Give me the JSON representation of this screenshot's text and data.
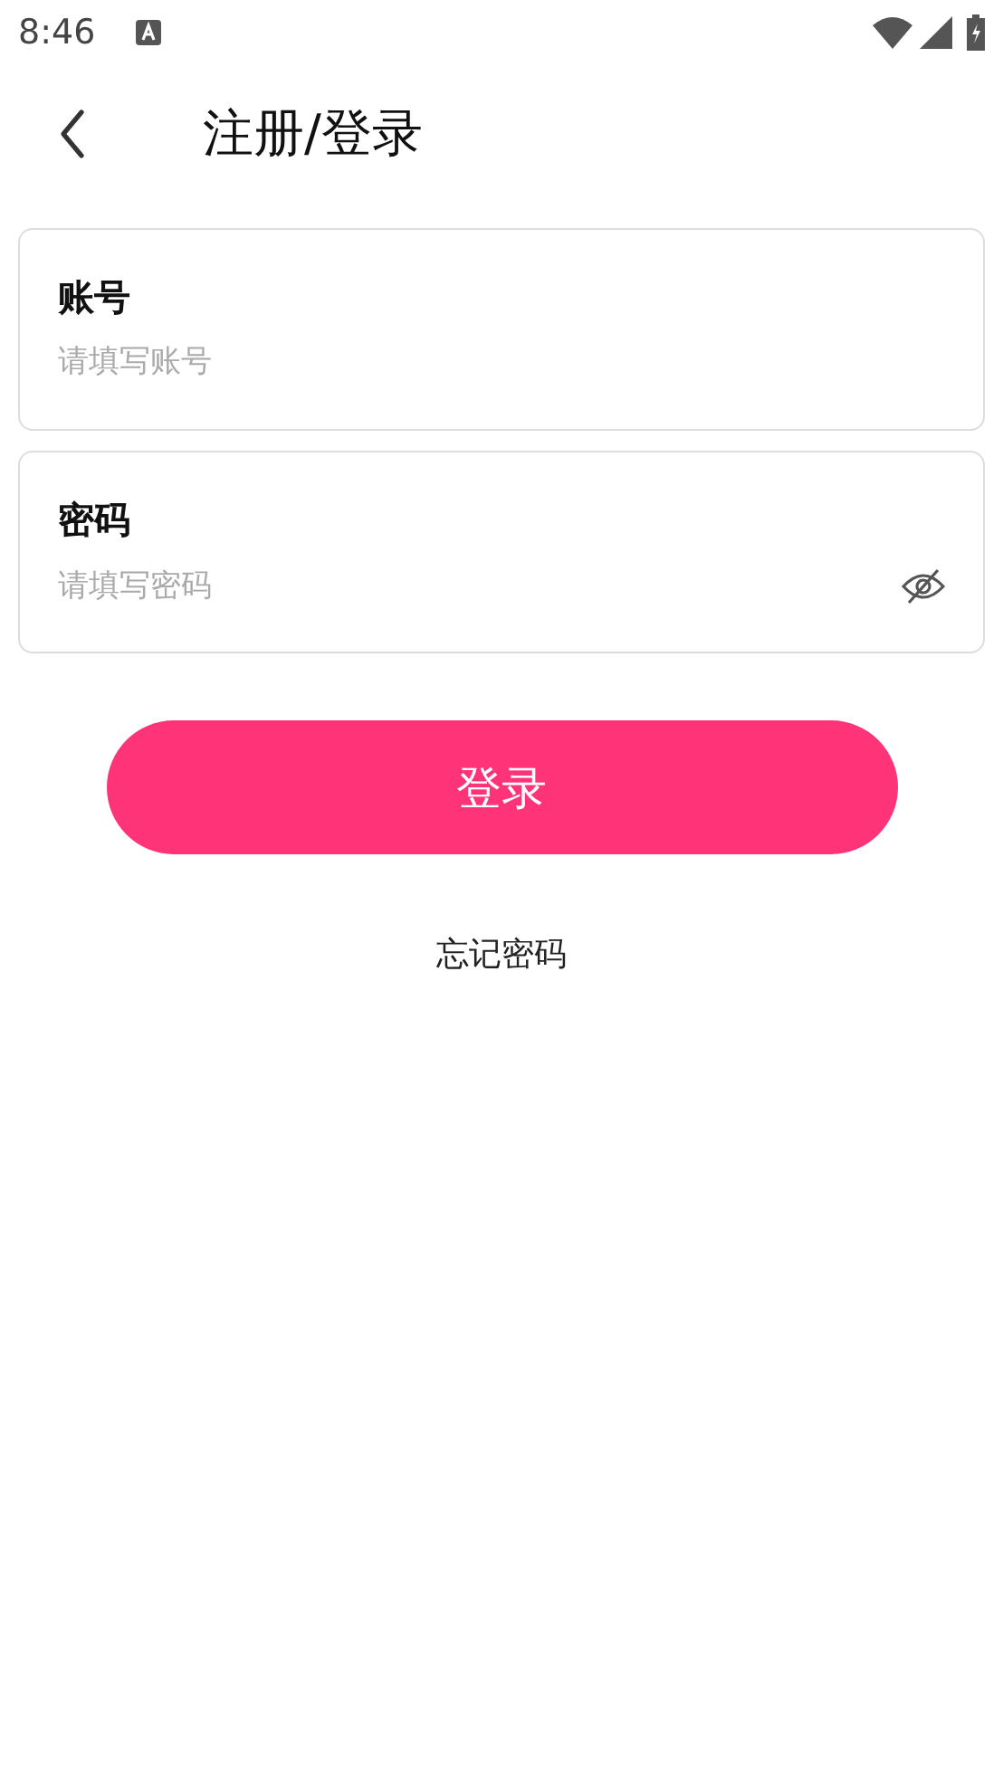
{
  "status_bar": {
    "time": "8:46"
  },
  "header": {
    "title": "注册/登录"
  },
  "fields": [
    {
      "kind": "text",
      "label": "账号",
      "placeholder": "请填写账号"
    },
    {
      "kind": "password",
      "label": "密码",
      "placeholder": "请填写密码"
    }
  ],
  "login_button": {
    "label": "登录"
  },
  "forgot_password_link": {
    "label": "忘记密码"
  }
}
